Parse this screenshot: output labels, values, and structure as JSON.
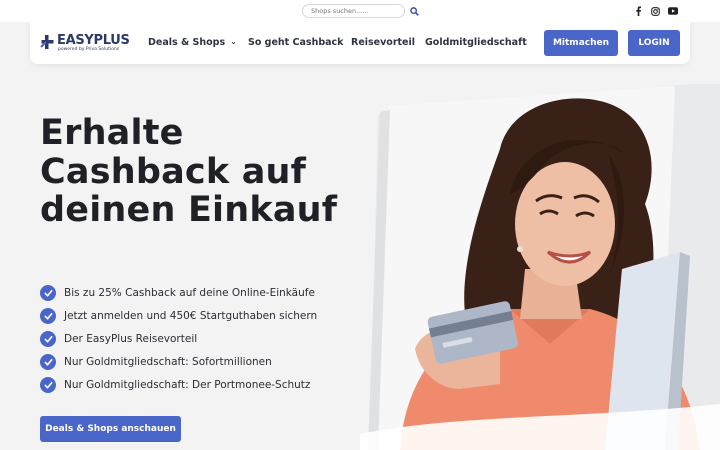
{
  "topbar": {
    "search_placeholder": "Shops suchen......",
    "search_icon": "search-icon",
    "social": [
      "facebook-icon",
      "instagram-icon",
      "youtube-icon"
    ]
  },
  "brand": {
    "name": "EASYPLUS",
    "tagline": "powered by Priva Solutions"
  },
  "nav": {
    "items": [
      "Deals & Shops",
      "So geht Cashback",
      "Reisevorteil",
      "Goldmitgliedschaft"
    ],
    "join_label": "Mitmachen",
    "login_label": "LOGIN"
  },
  "hero": {
    "title": "Erhalte Cashback auf deinen Einkauf",
    "features": [
      "Bis zu 25% Cashback auf deine Online-Einkäufe",
      "Jetzt anmelden und 450€ Startguthaben sichern",
      "Der EasyPlus Reisevorteil",
      "Nur Goldmitgliedschaft: Sofortmillionen",
      "Nur Goldmitgliedschaft: Der Portmonee-Schutz"
    ],
    "cta_label": "Deals & Shops anschauen"
  },
  "colors": {
    "accent": "#4a66c9",
    "brand_dark": "#2b3a67",
    "background": "#f3f3f4"
  }
}
